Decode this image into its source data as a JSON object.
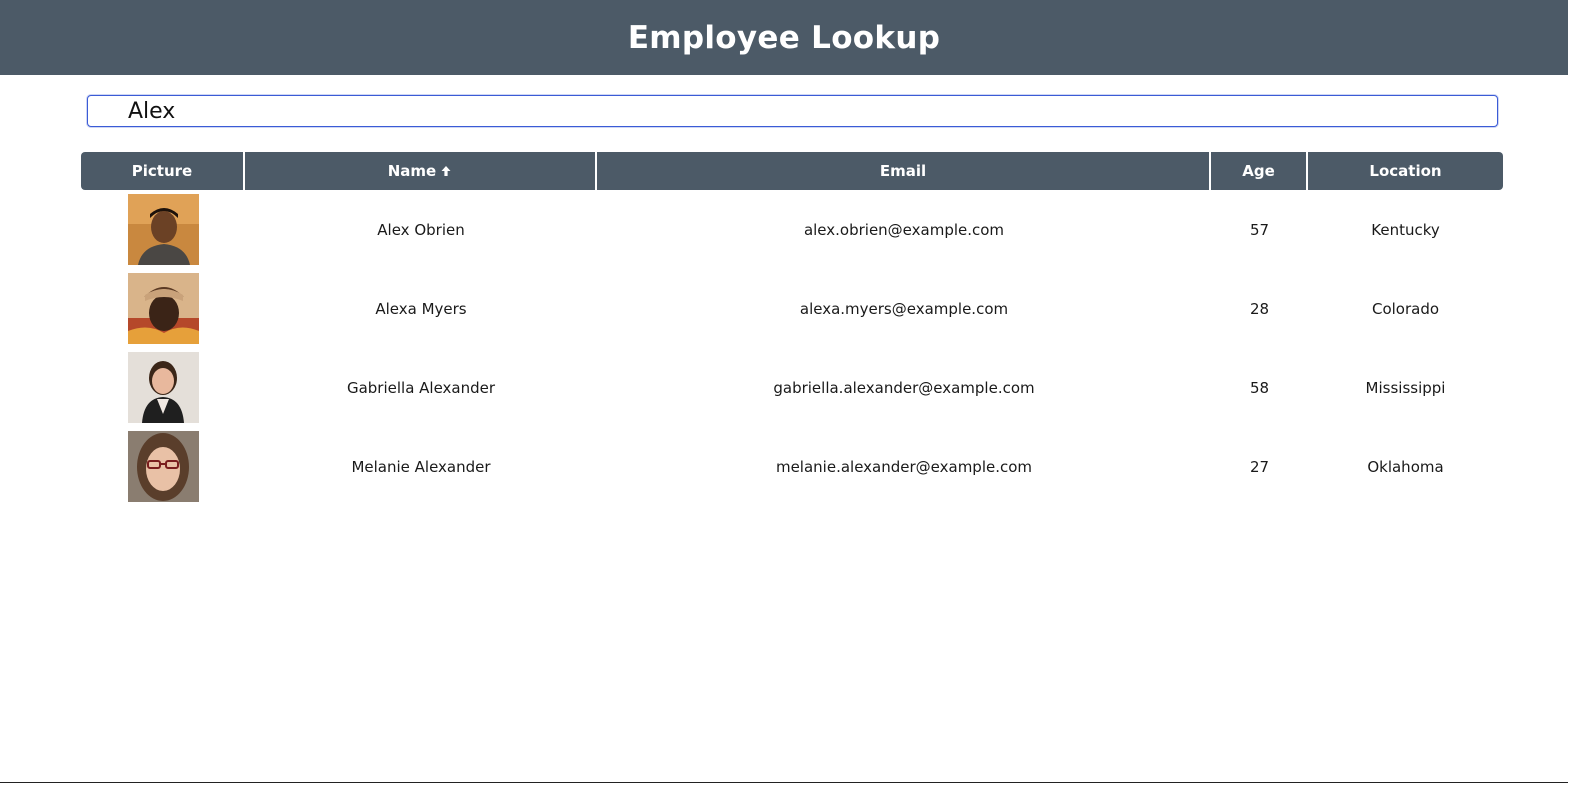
{
  "header": {
    "title": "Employee Lookup"
  },
  "search": {
    "value": "Alex",
    "placeholder": ""
  },
  "table": {
    "columns": {
      "picture": "Picture",
      "name": "Name",
      "email": "Email",
      "age": "Age",
      "location": "Location"
    },
    "sort": {
      "column": "name",
      "direction": "ascending",
      "icon": "arrow-up-icon"
    },
    "rows": [
      {
        "picture": "avatar-photo",
        "name": "Alex Obrien",
        "email": "alex.obrien@example.com",
        "age": "57",
        "location": "Kentucky"
      },
      {
        "picture": "avatar-photo",
        "name": "Alexa Myers",
        "email": "alexa.myers@example.com",
        "age": "28",
        "location": "Colorado"
      },
      {
        "picture": "avatar-photo",
        "name": "Gabriella Alexander",
        "email": "gabriella.alexander@example.com",
        "age": "58",
        "location": "Mississippi"
      },
      {
        "picture": "avatar-photo",
        "name": "Melanie Alexander",
        "email": "melanie.alexander@example.com",
        "age": "27",
        "location": "Oklahoma"
      }
    ]
  },
  "colors": {
    "header_bg": "#4c5a67",
    "header_text": "#ffffff",
    "input_border": "#3b5bd6"
  }
}
